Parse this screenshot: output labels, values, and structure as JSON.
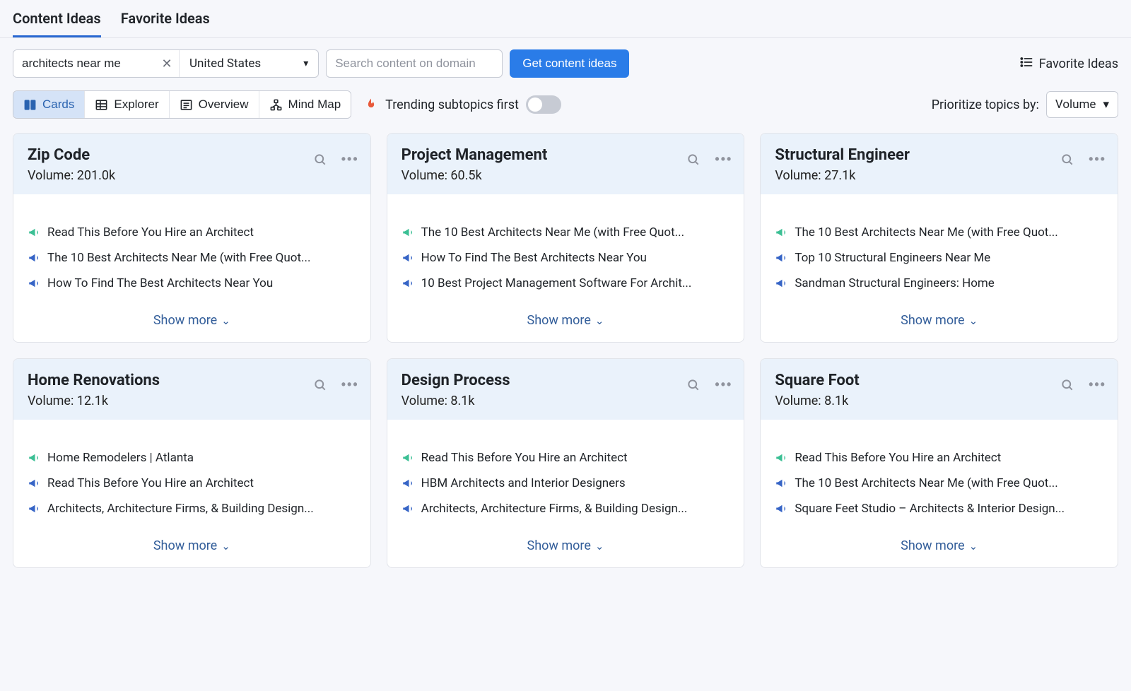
{
  "tabs": {
    "content_ideas": "Content Ideas",
    "favorite_ideas": "Favorite Ideas"
  },
  "toolbar": {
    "keyword_value": "architects near me",
    "country_value": "United States",
    "domain_placeholder": "Search content on domain",
    "get_ideas_label": "Get content ideas",
    "favorite_ideas_link": "Favorite Ideas"
  },
  "viewbar": {
    "cards": "Cards",
    "explorer": "Explorer",
    "overview": "Overview",
    "mind_map": "Mind Map",
    "trending_label": "Trending subtopics first",
    "prioritize_label": "Prioritize topics by:",
    "prioritize_value": "Volume"
  },
  "volume_prefix": "Volume: ",
  "show_more_label": "Show more",
  "cards": [
    {
      "title": "Zip Code",
      "volume": "201.0k",
      "ideas": [
        {
          "color": "green",
          "text": "Read This Before You Hire an Architect"
        },
        {
          "color": "blue",
          "text": "The 10 Best Architects Near Me (with Free Quot..."
        },
        {
          "color": "blue",
          "text": "How To Find The Best Architects Near You"
        }
      ]
    },
    {
      "title": "Project Management",
      "volume": "60.5k",
      "ideas": [
        {
          "color": "green",
          "text": "The 10 Best Architects Near Me (with Free Quot..."
        },
        {
          "color": "blue",
          "text": "How To Find The Best Architects Near You"
        },
        {
          "color": "blue",
          "text": "10 Best Project Management Software For Archit..."
        }
      ]
    },
    {
      "title": "Structural Engineer",
      "volume": "27.1k",
      "ideas": [
        {
          "color": "green",
          "text": "The 10 Best Architects Near Me (with Free Quot..."
        },
        {
          "color": "blue",
          "text": "Top 10 Structural Engineers Near Me"
        },
        {
          "color": "blue",
          "text": "Sandman Structural Engineers: Home"
        }
      ]
    },
    {
      "title": "Home Renovations",
      "volume": "12.1k",
      "ideas": [
        {
          "color": "green",
          "text": "Home Remodelers | Atlanta"
        },
        {
          "color": "blue",
          "text": "Read This Before You Hire an Architect"
        },
        {
          "color": "blue",
          "text": "Architects, Architecture Firms, & Building Design..."
        }
      ]
    },
    {
      "title": "Design Process",
      "volume": "8.1k",
      "ideas": [
        {
          "color": "green",
          "text": "Read This Before You Hire an Architect"
        },
        {
          "color": "blue",
          "text": "HBM Architects and Interior Designers"
        },
        {
          "color": "blue",
          "text": "Architects, Architecture Firms, & Building Design..."
        }
      ]
    },
    {
      "title": "Square Foot",
      "volume": "8.1k",
      "ideas": [
        {
          "color": "green",
          "text": "Read This Before You Hire an Architect"
        },
        {
          "color": "blue",
          "text": "The 10 Best Architects Near Me (with Free Quot..."
        },
        {
          "color": "blue",
          "text": "Square Feet Studio – Architects & Interior Design..."
        }
      ]
    }
  ]
}
